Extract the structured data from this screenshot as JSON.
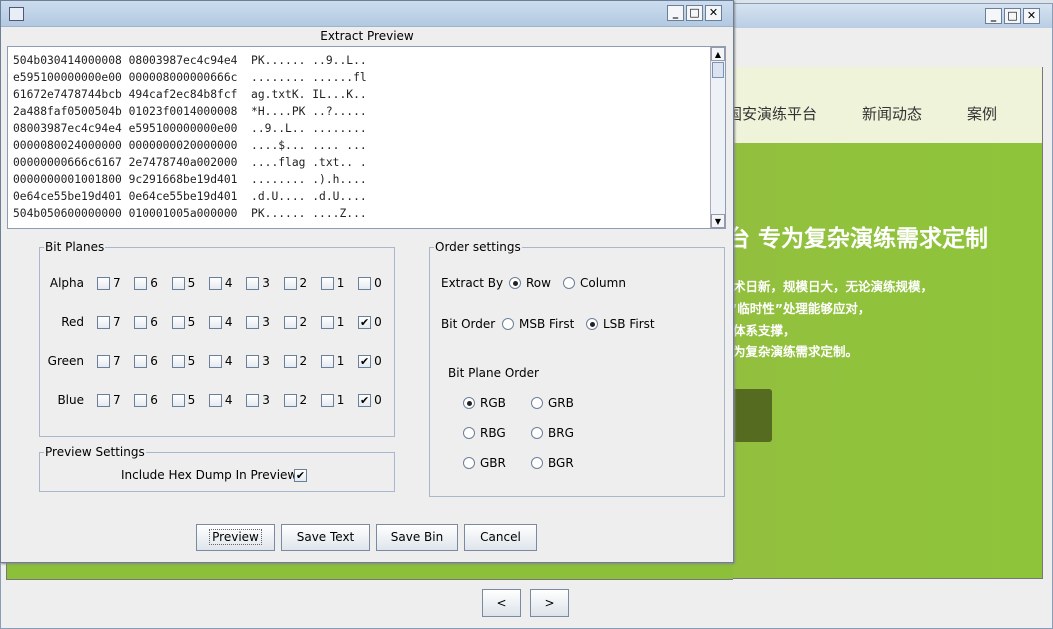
{
  "back_window": {
    "controls": {
      "minimize": "_",
      "maximize": "□",
      "close": "✕"
    },
    "site": {
      "nav": [
        "国安演练平台",
        "新闻动态",
        "案例"
      ],
      "hero_title": "台 专为复杂演练需求定制",
      "hero_lines": [
        "术日新，规模日大，无论演练规模，",
        "“临时性”处理能够应对，",
        "体系支撑，",
        "为复杂演练需求定制。"
      ]
    },
    "prev_label": "<",
    "next_label": ">"
  },
  "dialog": {
    "controls": {
      "minimize": "_",
      "maximize": "□",
      "close": "✕"
    },
    "title": "Extract Preview",
    "hex_lines": [
      "504b030414000008 08003987ec4c94e4  PK...... ..9..L..",
      "e595100000000e00 000008000000666c  ........ ......fl",
      "61672e7478744bcb 494caf2ec84b8fcf  ag.txtK. IL...K..",
      "2a488faf0500504b 01023f0014000008  *H....PK ..?.....",
      "08003987ec4c94e4 e595100000000e00  ..9..L.. ........",
      "0000080024000000 0000000020000000  ....$... .... ...",
      "00000000666c6167 2e7478740a002000  ....flag .txt.. .",
      "0000000001001800 9c291668be19d401  ........ .).h....",
      "0e64ce55be19d401 0e64ce55be19d401  .d.U.... .d.U....",
      "504b050600000000 010001005a000000  PK...... ....Z..."
    ],
    "bit_planes": {
      "legend": "Bit Planes",
      "bits": [
        "7",
        "6",
        "5",
        "4",
        "3",
        "2",
        "1",
        "0"
      ],
      "rows": [
        {
          "label": "Alpha",
          "checked": [
            false,
            false,
            false,
            false,
            false,
            false,
            false,
            false
          ]
        },
        {
          "label": "Red",
          "checked": [
            false,
            false,
            false,
            false,
            false,
            false,
            false,
            true
          ]
        },
        {
          "label": "Green",
          "checked": [
            false,
            false,
            false,
            false,
            false,
            false,
            false,
            true
          ]
        },
        {
          "label": "Blue",
          "checked": [
            false,
            false,
            false,
            false,
            false,
            false,
            false,
            true
          ]
        }
      ]
    },
    "preview_settings": {
      "legend": "Preview Settings",
      "hex_dump_label": "Include Hex Dump In Preview",
      "hex_dump_checked": true
    },
    "order_settings": {
      "legend": "Order settings",
      "extract_by_label": "Extract By",
      "extract_by_options": [
        "Row",
        "Column"
      ],
      "extract_by_selected": "Row",
      "bit_order_label": "Bit Order",
      "bit_order_options": [
        "MSB First",
        "LSB First"
      ],
      "bit_order_selected": "LSB First",
      "plane_order_label": "Bit Plane Order",
      "plane_order_options": [
        "RGB",
        "GRB",
        "RBG",
        "BRG",
        "GBR",
        "BGR"
      ],
      "plane_order_selected": "RGB"
    },
    "buttons": {
      "preview": "Preview",
      "save_text": "Save Text",
      "save_bin": "Save Bin",
      "cancel": "Cancel"
    }
  }
}
